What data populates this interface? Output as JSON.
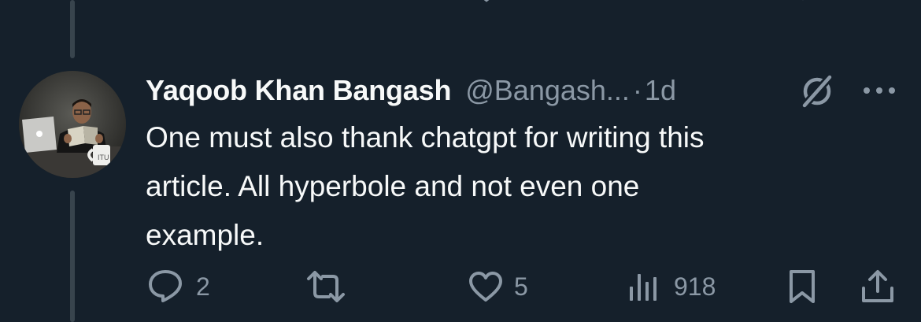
{
  "colors": {
    "background": "#15202b",
    "text_primary": "#f7f9f9",
    "text_secondary": "#8b98a5",
    "thread_line": "#38444d"
  },
  "tweet": {
    "display_name": "Yaqoob Khan Bangash",
    "handle": "@Bangash...",
    "separator": "·",
    "timestamp": "1d",
    "text": "One must also thank chatgpt for writing this\narticle. All hyperbole and not even one\nexample.",
    "avatar_icon": "user-avatar-photo",
    "grok_icon": "grok-icon",
    "more_icon": "more-options-icon"
  },
  "actions": {
    "reply": {
      "icon": "reply-icon",
      "count": "2"
    },
    "retweet": {
      "icon": "retweet-icon",
      "count": ""
    },
    "like": {
      "icon": "heart-icon",
      "count": "5"
    },
    "views": {
      "icon": "views-icon",
      "count": "918"
    },
    "bookmark": {
      "icon": "bookmark-icon"
    },
    "share": {
      "icon": "share-icon"
    }
  }
}
